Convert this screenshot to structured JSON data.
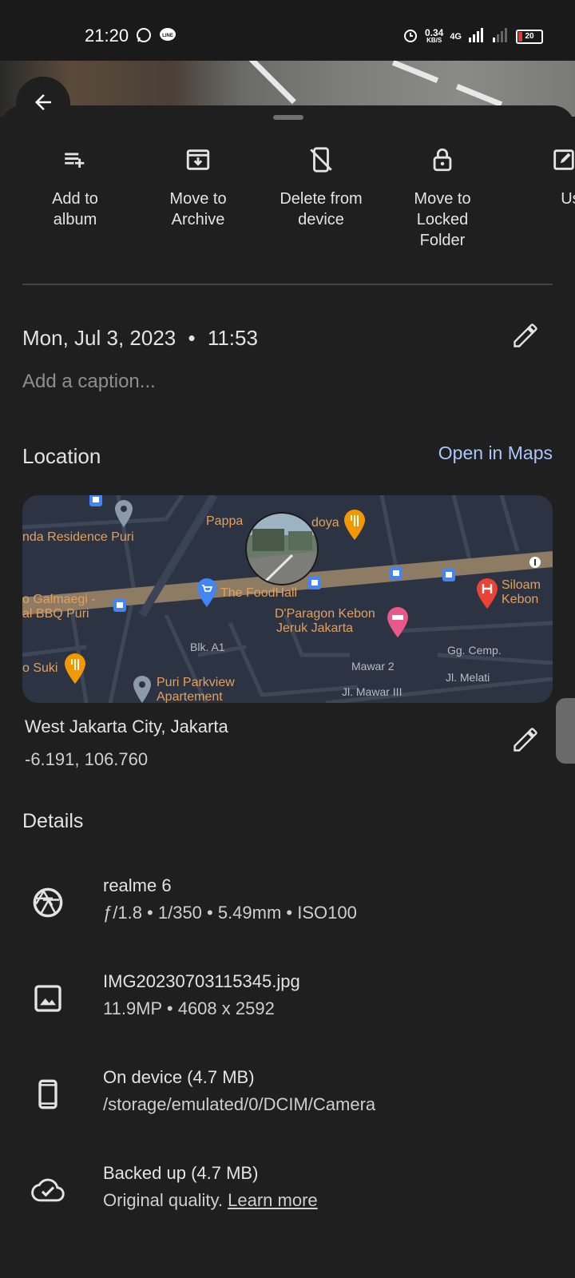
{
  "status_bar": {
    "time": "21:20",
    "speed_value": "0.34",
    "speed_unit": "KB/S",
    "network": "4G",
    "battery": "20"
  },
  "actions": [
    {
      "label": "Add to\nalbum",
      "icon": "playlist-add-icon"
    },
    {
      "label": "Move to\nArchive",
      "icon": "archive-icon"
    },
    {
      "label": "Delete from\ndevice",
      "icon": "delete-device-icon"
    },
    {
      "label": "Move to\nLocked\nFolder",
      "icon": "lock-icon"
    },
    {
      "label": "Use",
      "icon": "edit-box-icon"
    }
  ],
  "info": {
    "date": "Mon, Jul 3, 2023",
    "separator": "•",
    "time": "11:53",
    "caption_placeholder": "Add a caption..."
  },
  "location": {
    "title": "Location",
    "open_maps": "Open in Maps",
    "place": "West Jakarta City, Jakarta",
    "coords": "-6.191, 106.760",
    "map_labels": {
      "residence": "nda Residence Puri",
      "pappa": "Pappa",
      "doya": "doya",
      "galmaegi1": "o Galmaegi -",
      "galmaegi2": "al BBQ Puri",
      "foodhall": "The FoodHall",
      "siloam1": "Siloam",
      "siloam2": "Kebon",
      "dparagon1": "D'Paragon Kebon",
      "dparagon2": "Jeruk Jakarta",
      "blk": "Blk. A1",
      "gg": "Gg. Cemp.",
      "mawar2": "Mawar 2",
      "melati": "Jl. Melati",
      "mawar3": "Jl. Mawar III",
      "suki": "o Suki",
      "puri1": "Puri Parkview",
      "puri2": "Apartement"
    }
  },
  "details": {
    "title": "Details",
    "camera": {
      "name": "realme 6",
      "specs": "ƒ/1.8  •  1/350  •  5.49mm  •  ISO100"
    },
    "file": {
      "name": "IMG20230703115345.jpg",
      "specs": "11.9MP  •  4608 x 2592"
    },
    "storage": {
      "title": "On device (4.7 MB)",
      "path": "/storage/emulated/0/DCIM/Camera"
    },
    "backup": {
      "title": "Backed up (4.7 MB)",
      "quality": "Original quality.",
      "learn_more": "Learn more"
    }
  },
  "colors": {
    "background": "#1f1f1f",
    "accent_link": "#a8c7fa",
    "map_bg": "#2c3443",
    "map_road": "#8d7b63"
  }
}
